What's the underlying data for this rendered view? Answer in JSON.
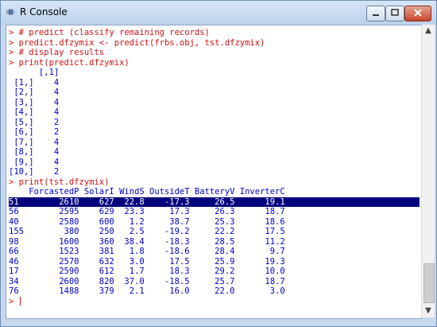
{
  "window": {
    "title": "R Console"
  },
  "console": {
    "lines": [
      {
        "text": "> # predict (classify remaining records)",
        "type": "cmd"
      },
      {
        "text": "> predict.dfzymix <- predict(frbs.obj, tst.dfzymix)",
        "type": "cmd"
      },
      {
        "text": "> # display results",
        "type": "cmd"
      },
      {
        "text": "> print(predict.dfzymix)",
        "type": "cmd"
      },
      {
        "text": "      [,1]",
        "type": "out"
      },
      {
        "text": " [1,]    4",
        "type": "out"
      },
      {
        "text": " [2,]    4",
        "type": "out"
      },
      {
        "text": " [3,]    4",
        "type": "out"
      },
      {
        "text": " [4,]    4",
        "type": "out"
      },
      {
        "text": " [5,]    2",
        "type": "out"
      },
      {
        "text": " [6,]    2",
        "type": "out"
      },
      {
        "text": " [7,]    4",
        "type": "out"
      },
      {
        "text": " [8,]    4",
        "type": "out"
      },
      {
        "text": " [9,]    4",
        "type": "out"
      },
      {
        "text": "[10,]    2",
        "type": "out"
      },
      {
        "text": "> print(tst.dfzymix)",
        "type": "cmd"
      },
      {
        "text": "    ForcastedP SolarI WindS OutsideT BatteryV InverterC",
        "type": "out"
      },
      {
        "text": "51        2610    627  22.8    -17.3     26.5      19.1",
        "type": "highlight"
      },
      {
        "text": "56        2595    629  23.3     17.3     26.3      18.7",
        "type": "out"
      },
      {
        "text": "40        2580    600   1.2     38.7     25.3      18.6",
        "type": "out"
      },
      {
        "text": "155        380    250   2.5    -19.2     22.2      17.5",
        "type": "out"
      },
      {
        "text": "98        1600    360  38.4    -18.3     28.5      11.2",
        "type": "out"
      },
      {
        "text": "66        1523    381   1.8    -18.6     28.4       9.7",
        "type": "out"
      },
      {
        "text": "46        2570    632   3.0     17.5     25.9      19.3",
        "type": "out"
      },
      {
        "text": "17        2590    612   1.7     18.3     29.2      10.0",
        "type": "out"
      },
      {
        "text": "34        2600    820  37.0    -18.5     25.7      18.7",
        "type": "out"
      },
      {
        "text": "76        1488    379   2.1     16.0     22.0       3.0",
        "type": "out"
      },
      {
        "text": "> ",
        "type": "prompt"
      }
    ]
  },
  "colors": {
    "command": "#d21010",
    "output": "#0000cc",
    "highlight_bg": "#00007c"
  },
  "icons": {
    "app": "r-logo-icon",
    "minimize": "minimize-icon",
    "maximize": "maximize-icon",
    "close": "close-icon"
  }
}
